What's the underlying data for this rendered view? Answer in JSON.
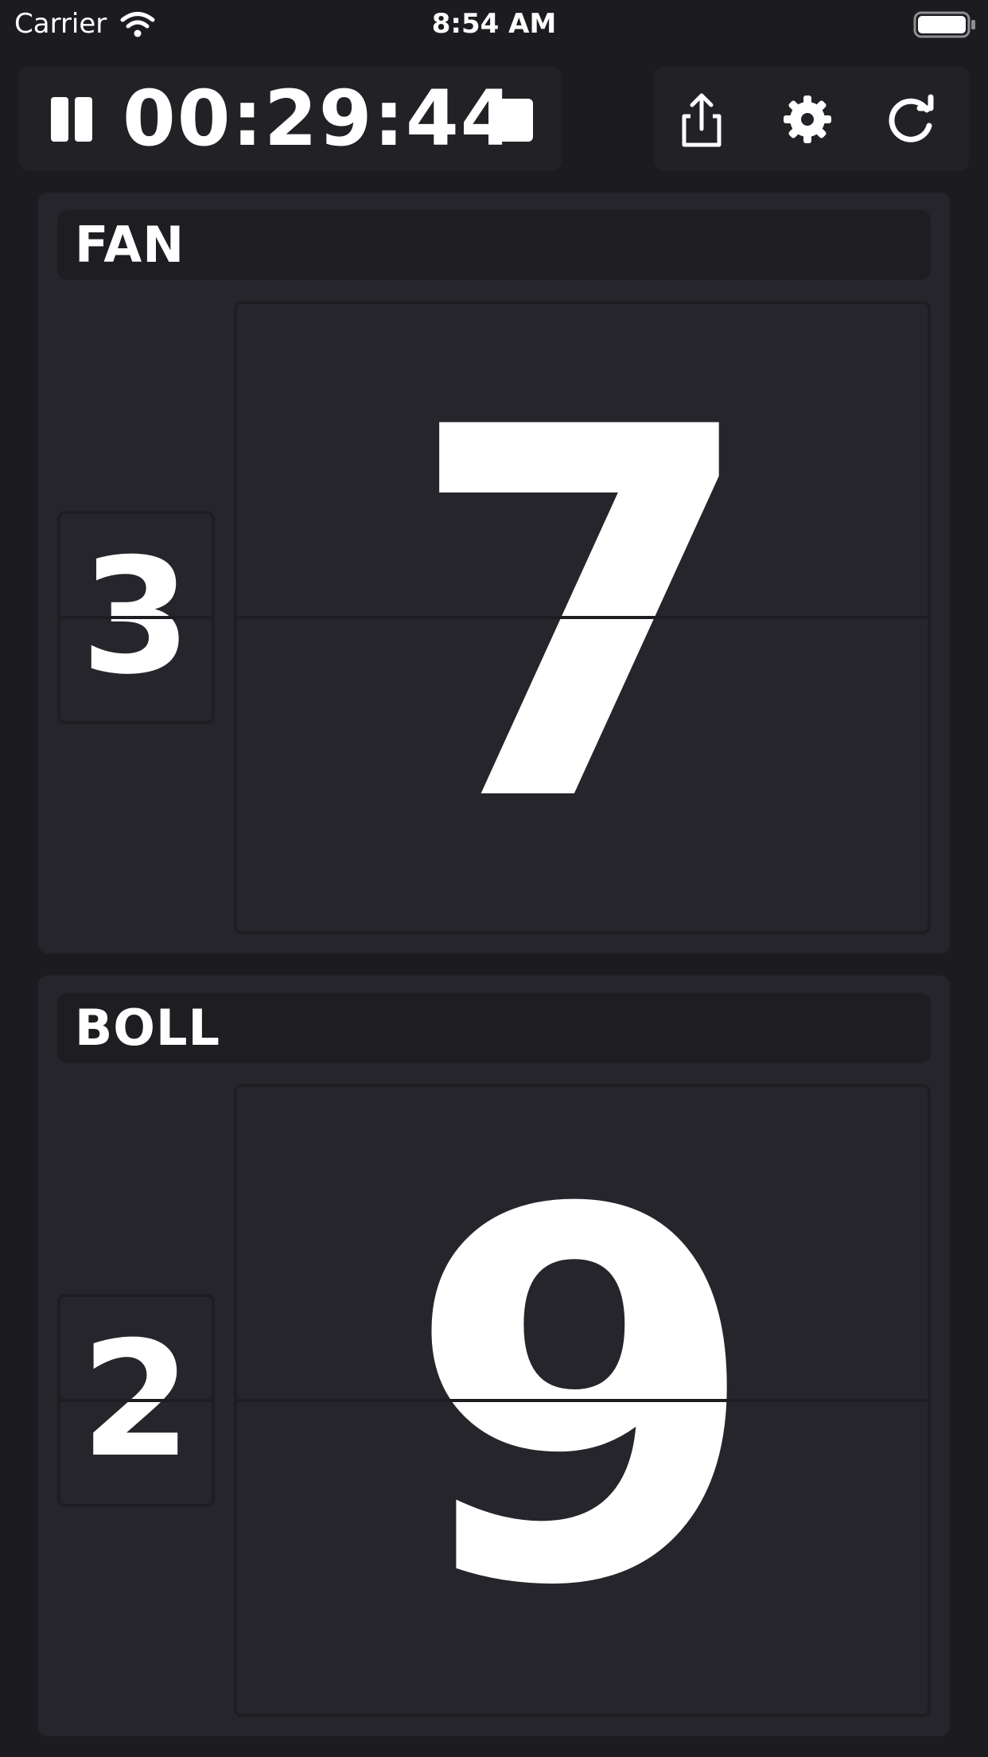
{
  "status_bar": {
    "carrier": "Carrier",
    "time": "8:54 AM",
    "wifi_icon": "wifi-icon",
    "battery_icon": "battery-full-icon"
  },
  "timer": {
    "pause_icon": "pause-icon",
    "value": "00:29:44",
    "stop_icon": "stop-icon"
  },
  "actions": {
    "share_icon": "share-icon",
    "settings_icon": "gear-icon",
    "reset_icon": "refresh-icon"
  },
  "teams": [
    {
      "name": "FAN",
      "sets": "3",
      "score": "7"
    },
    {
      "name": "BOLL",
      "sets": "2",
      "score": "9"
    }
  ],
  "colors": {
    "background": "#1c1c20",
    "panel": "#212126",
    "card": "#25252b",
    "text": "#ffffff"
  }
}
